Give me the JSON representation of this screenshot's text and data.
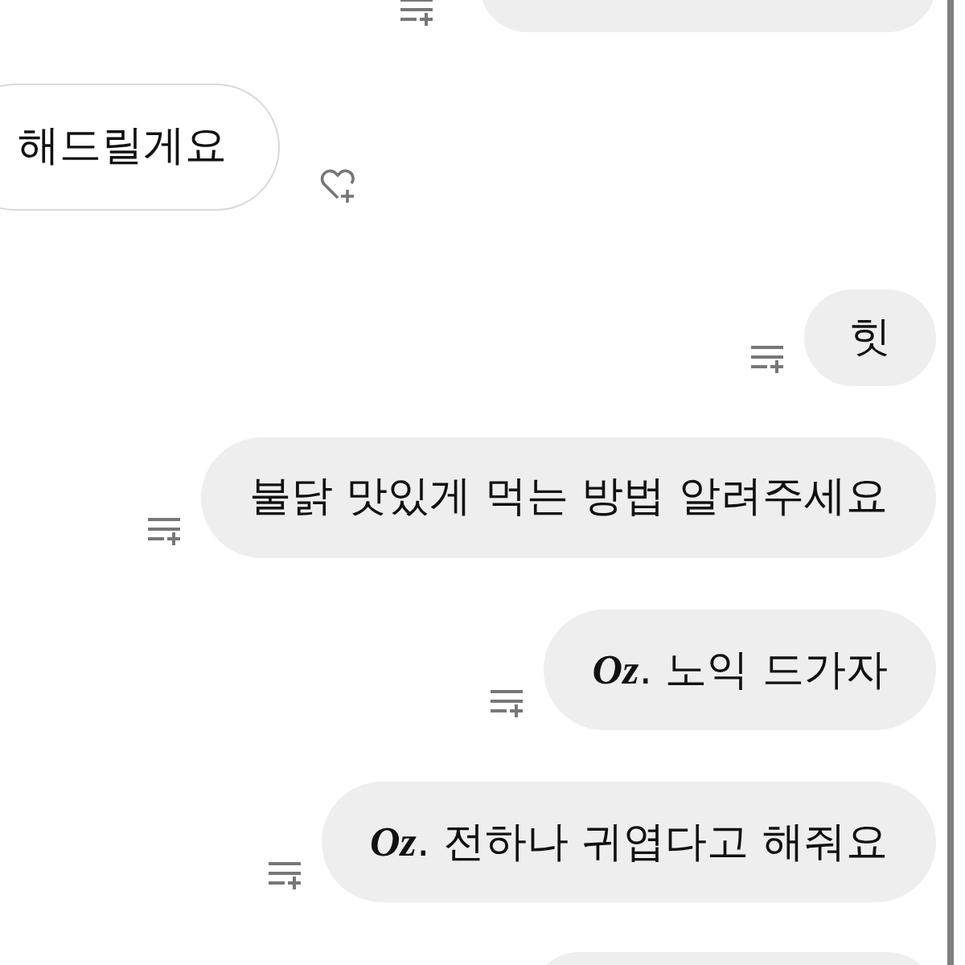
{
  "messages": [
    {
      "kind": "sent_cut_top"
    },
    {
      "kind": "received",
      "text": "해드릴게요"
    },
    {
      "kind": "sent_short",
      "text": "힛"
    },
    {
      "kind": "sent",
      "text": "불닭 맛있게 먹는 방법 알려주세요"
    },
    {
      "kind": "sent",
      "text": "*Oz*. 노익 드가자"
    },
    {
      "kind": "sent",
      "text": "*Oz*. 전하나 귀엽다고 해줘요"
    },
    {
      "kind": "sent_cut_bottom"
    }
  ]
}
